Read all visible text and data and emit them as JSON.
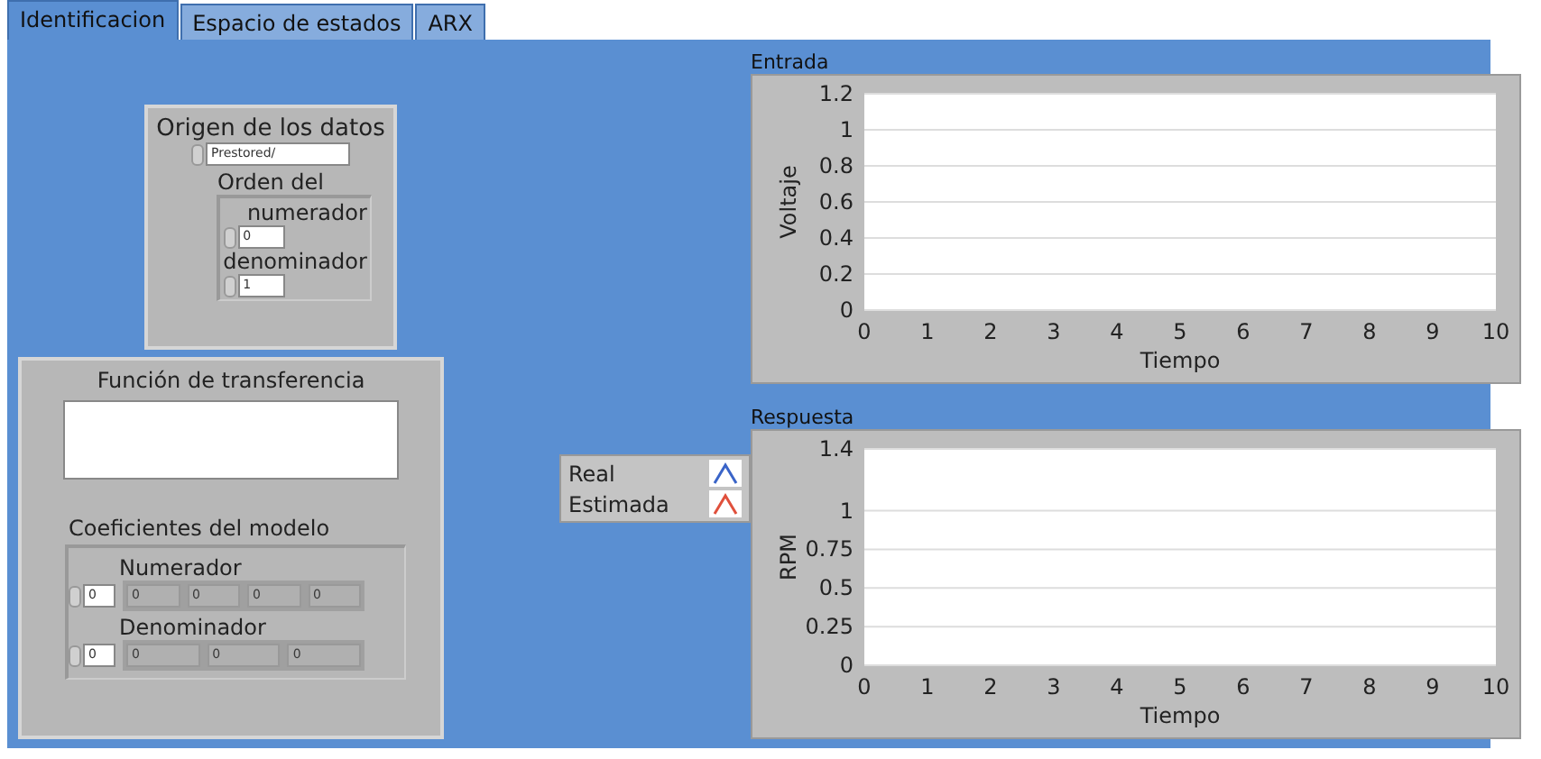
{
  "tabs": [
    {
      "label": "Identificacion",
      "selected": true
    },
    {
      "label": "Espacio de estados",
      "selected": false
    },
    {
      "label": "ARX",
      "selected": false
    }
  ],
  "origin_panel": {
    "title": "Origen de los datos",
    "source": {
      "value": "Prestored/"
    },
    "order_label": "Orden del",
    "order": [
      {
        "label": "numerador",
        "value": "0"
      },
      {
        "label": "denominador",
        "value": "1"
      }
    ]
  },
  "transfer_panel": {
    "title": "Función de transferencia",
    "coefficients_label": "Coeficientes del modelo",
    "groups": [
      {
        "label": "Numerador",
        "index": "0",
        "fields": [
          {
            "value": "0",
            "disabled": true
          },
          {
            "value": "0",
            "disabled": true
          },
          {
            "value": "0",
            "disabled": true
          },
          {
            "value": "0",
            "disabled": true
          }
        ]
      },
      {
        "label": "Denominador",
        "index": "0",
        "fields": [
          {
            "value": "0",
            "disabled": true
          },
          {
            "value": "0",
            "disabled": true
          },
          {
            "value": "0",
            "disabled": true
          }
        ]
      }
    ]
  },
  "legend": [
    {
      "name": "Real",
      "color": "#3a64c8"
    },
    {
      "name": "Estimada",
      "color": "#e0503c"
    }
  ],
  "charts": [
    {
      "label": "Entrada",
      "chart_data": {
        "type": "line",
        "xlabel": "Tiempo",
        "ylabel": "Voltaje",
        "grid": true,
        "xlim": [
          0,
          10
        ],
        "ylim": [
          0,
          1.2
        ],
        "xticks": [
          0,
          1,
          2,
          3,
          4,
          5,
          6,
          7,
          8,
          9,
          10
        ],
        "yticks": [
          0,
          0.2,
          0.4,
          0.6,
          0.8,
          1,
          1.2
        ]
      }
    },
    {
      "label": "Respuesta",
      "chart_data": {
        "type": "line",
        "xlabel": "Tiempo",
        "ylabel": "RPM",
        "grid": true,
        "xlim": [
          0,
          10
        ],
        "ylim": [
          0,
          1.4
        ],
        "xticks": [
          0,
          1,
          2,
          3,
          4,
          5,
          6,
          7,
          8,
          9,
          10
        ],
        "yticks": [
          0,
          0.25,
          0.5,
          0.75,
          1,
          1.4
        ]
      }
    }
  ]
}
